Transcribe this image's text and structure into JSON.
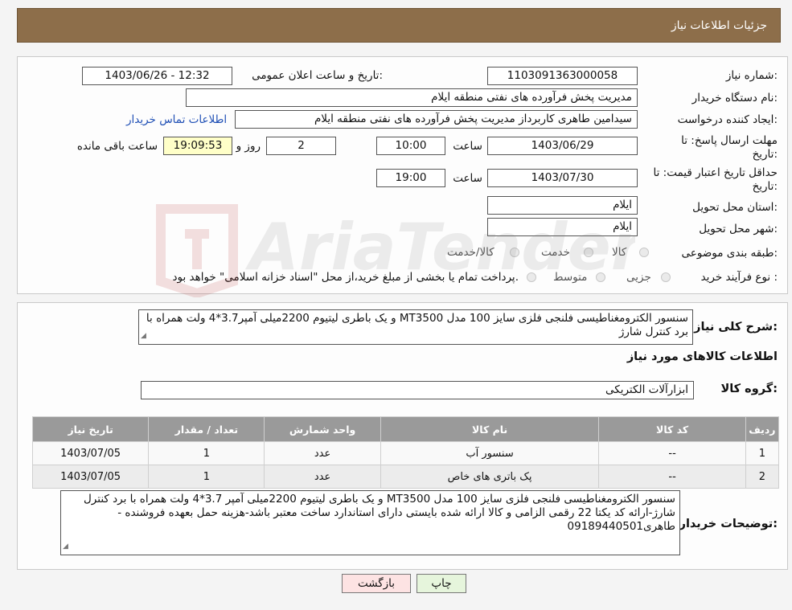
{
  "header": {
    "title": "جزئیات اطلاعات نیاز"
  },
  "form": {
    "need_number": {
      "label": "شماره نیاز:",
      "value": "1103091363000058"
    },
    "announce_datetime": {
      "label": "تاریخ و ساعت اعلان عمومی:",
      "value": "1403/06/26 - 12:32"
    },
    "buyer_org": {
      "label": "نام دستگاه خریدار:",
      "value": "مدیریت پخش فرآورده های نفتی منطقه ایلام"
    },
    "requester": {
      "label": "ایجاد کننده درخواست:",
      "value": "سیدامین طاهری کاربرداز مدیریت پخش فرآورده های نفتی منطقه ایلام"
    },
    "buyer_contact_link": "اطلاعات تماس خریدار",
    "reply_deadline": {
      "label_line1": "مهلت ارسال پاسخ: تا",
      "label_line2": "تاریخ:",
      "date": "1403/06/29",
      "time_label": "ساعت",
      "time": "10:00",
      "days": "2",
      "days_label": "روز و",
      "remaining": "19:09:53",
      "remaining_label": "ساعت باقی مانده"
    },
    "price_validity": {
      "label_line1": "حداقل تاریخ اعتبار قیمت: تا",
      "label_line2": "تاریخ:",
      "date": "1403/07/30",
      "time_label": "ساعت",
      "time": "19:00"
    },
    "delivery_province": {
      "label": "استان محل تحویل:",
      "value": "ایلام"
    },
    "delivery_city": {
      "label": "شهر محل تحویل:",
      "value": "ایلام"
    },
    "category": {
      "label": "طبقه بندی موضوعی:",
      "options": [
        "کالا",
        "خدمت",
        "کالا/خدمت"
      ]
    },
    "purchase_type": {
      "label": "نوع فرآیند خرید :",
      "options": [
        "جزیی",
        "متوسط"
      ],
      "note": "پرداخت تمام یا بخشی از مبلغ خرید،از محل \"اسناد خزانه اسلامی\" خواهد بود."
    }
  },
  "summary": {
    "label": "شرح کلی نیاز:",
    "text": "سنسور الکترومغناطیسی فلنجی فلزی سایز 100 مدل MT3500 و یک باطری لیتیوم 2200میلی آمپر3.7*4 ولت همراه با برد کنترل شارژ"
  },
  "goods_info_title": "اطلاعات کالاهای مورد نیاز",
  "goods_group": {
    "label": "گروه کالا:",
    "value": "ابزارآلات الکتریکی"
  },
  "table": {
    "headers": [
      "ردیف",
      "کد کالا",
      "نام کالا",
      "واحد شمارش",
      "تعداد / مقدار",
      "تاریخ نیاز"
    ],
    "rows": [
      [
        "1",
        "--",
        "سنسور آب",
        "عدد",
        "1",
        "1403/07/05"
      ],
      [
        "2",
        "--",
        "پک باتری های خاص",
        "عدد",
        "1",
        "1403/07/05"
      ]
    ]
  },
  "buyer_notes": {
    "label": "توضیحات خریدار:",
    "text": "سنسور الکترومغناطیسی فلنجی فلزی سایز 100 مدل MT3500 و یک باطری لیتیوم 2200میلی آمپر 3.7*4 ولت همراه با برد کنترل شارژ-ارائه کد یکتا 22 رقمی الزامی و کالا ارائه شده بایستی دارای استاندارد ساخت معتبر باشد-هزینه حمل بعهده فروشنده - طاهری09189440501"
  },
  "buttons": {
    "print": "چاپ",
    "back": "بازگشت"
  },
  "watermark_text": "AriaTender.neT",
  "colors": {
    "header_bg": "#8d6e4a",
    "table_header_bg": "#9a9a9a",
    "remaining_bg": "#ffffc8",
    "back_btn_bg": "#fde3e3",
    "print_btn_bg": "#e6f5dc",
    "link": "#1f4fb5"
  }
}
